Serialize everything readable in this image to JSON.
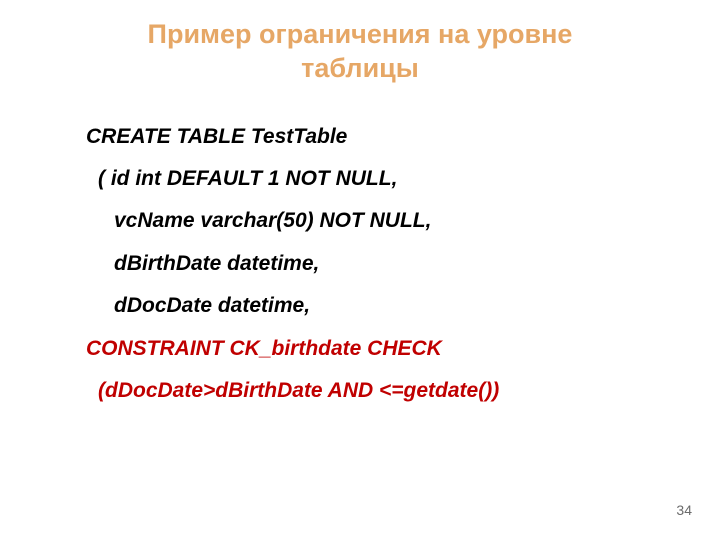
{
  "title": "Пример ограничения на уровне таблицы",
  "code": {
    "l1": "CREATE TABLE  TestTable",
    "l2": "( id int DEFAULT 1 NOT NULL,",
    "l3": "vcName varchar(50) NOT NULL,",
    "l4": "dBirthDate datetime,",
    "l5": "dDocDate datetime,",
    "l6": "CONSTRAINT CK_birthdate CHECK",
    "l7": "(dDocDate>dBirthDate AND <=getdate())"
  },
  "pageNumber": "34"
}
